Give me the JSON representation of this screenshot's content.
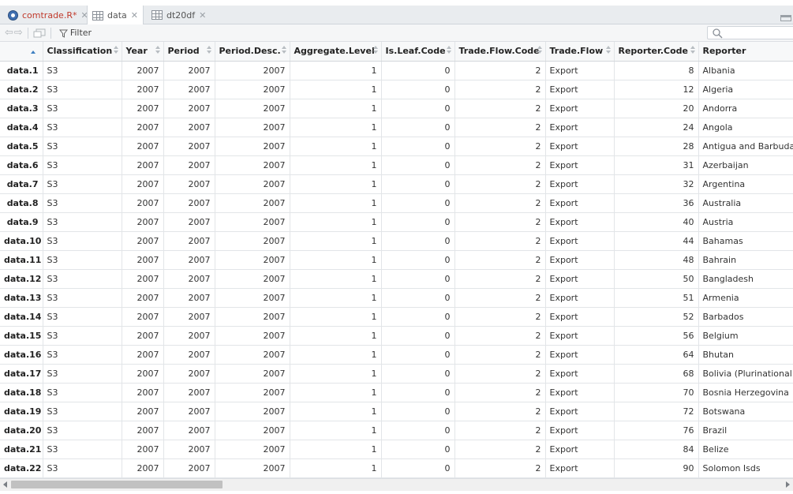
{
  "tabs": [
    {
      "label": "comtrade.R*",
      "icon": "r-script-icon",
      "active": false,
      "modified": true
    },
    {
      "label": "data",
      "icon": "data-grid-icon",
      "active": true,
      "modified": false
    },
    {
      "label": "dt20df",
      "icon": "data-grid-icon",
      "active": false,
      "modified": false
    }
  ],
  "toolbar": {
    "filter_label": "Filter",
    "search_placeholder": ""
  },
  "columns": [
    "",
    "Classification",
    "Year",
    "Period",
    "Period.Desc.",
    "Aggregate.Level",
    "Is.Leaf.Code",
    "Trade.Flow.Code",
    "Trade.Flow",
    "Reporter.Code",
    "Reporter"
  ],
  "rows": [
    [
      "data.1",
      "S3",
      "2007",
      "2007",
      "2007",
      "1",
      "0",
      "2",
      "Export",
      "8",
      "Albania"
    ],
    [
      "data.2",
      "S3",
      "2007",
      "2007",
      "2007",
      "1",
      "0",
      "2",
      "Export",
      "12",
      "Algeria"
    ],
    [
      "data.3",
      "S3",
      "2007",
      "2007",
      "2007",
      "1",
      "0",
      "2",
      "Export",
      "20",
      "Andorra"
    ],
    [
      "data.4",
      "S3",
      "2007",
      "2007",
      "2007",
      "1",
      "0",
      "2",
      "Export",
      "24",
      "Angola"
    ],
    [
      "data.5",
      "S3",
      "2007",
      "2007",
      "2007",
      "1",
      "0",
      "2",
      "Export",
      "28",
      "Antigua and Barbuda"
    ],
    [
      "data.6",
      "S3",
      "2007",
      "2007",
      "2007",
      "1",
      "0",
      "2",
      "Export",
      "31",
      "Azerbaijan"
    ],
    [
      "data.7",
      "S3",
      "2007",
      "2007",
      "2007",
      "1",
      "0",
      "2",
      "Export",
      "32",
      "Argentina"
    ],
    [
      "data.8",
      "S3",
      "2007",
      "2007",
      "2007",
      "1",
      "0",
      "2",
      "Export",
      "36",
      "Australia"
    ],
    [
      "data.9",
      "S3",
      "2007",
      "2007",
      "2007",
      "1",
      "0",
      "2",
      "Export",
      "40",
      "Austria"
    ],
    [
      "data.10",
      "S3",
      "2007",
      "2007",
      "2007",
      "1",
      "0",
      "2",
      "Export",
      "44",
      "Bahamas"
    ],
    [
      "data.11",
      "S3",
      "2007",
      "2007",
      "2007",
      "1",
      "0",
      "2",
      "Export",
      "48",
      "Bahrain"
    ],
    [
      "data.12",
      "S3",
      "2007",
      "2007",
      "2007",
      "1",
      "0",
      "2",
      "Export",
      "50",
      "Bangladesh"
    ],
    [
      "data.13",
      "S3",
      "2007",
      "2007",
      "2007",
      "1",
      "0",
      "2",
      "Export",
      "51",
      "Armenia"
    ],
    [
      "data.14",
      "S3",
      "2007",
      "2007",
      "2007",
      "1",
      "0",
      "2",
      "Export",
      "52",
      "Barbados"
    ],
    [
      "data.15",
      "S3",
      "2007",
      "2007",
      "2007",
      "1",
      "0",
      "2",
      "Export",
      "56",
      "Belgium"
    ],
    [
      "data.16",
      "S3",
      "2007",
      "2007",
      "2007",
      "1",
      "0",
      "2",
      "Export",
      "64",
      "Bhutan"
    ],
    [
      "data.17",
      "S3",
      "2007",
      "2007",
      "2007",
      "1",
      "0",
      "2",
      "Export",
      "68",
      "Bolivia (Plurinational Sta"
    ],
    [
      "data.18",
      "S3",
      "2007",
      "2007",
      "2007",
      "1",
      "0",
      "2",
      "Export",
      "70",
      "Bosnia Herzegovina"
    ],
    [
      "data.19",
      "S3",
      "2007",
      "2007",
      "2007",
      "1",
      "0",
      "2",
      "Export",
      "72",
      "Botswana"
    ],
    [
      "data.20",
      "S3",
      "2007",
      "2007",
      "2007",
      "1",
      "0",
      "2",
      "Export",
      "76",
      "Brazil"
    ],
    [
      "data.21",
      "S3",
      "2007",
      "2007",
      "2007",
      "1",
      "0",
      "2",
      "Export",
      "84",
      "Belize"
    ],
    [
      "data.22",
      "S3",
      "2007",
      "2007",
      "2007",
      "1",
      "0",
      "2",
      "Export",
      "90",
      "Solomon Isds"
    ]
  ]
}
